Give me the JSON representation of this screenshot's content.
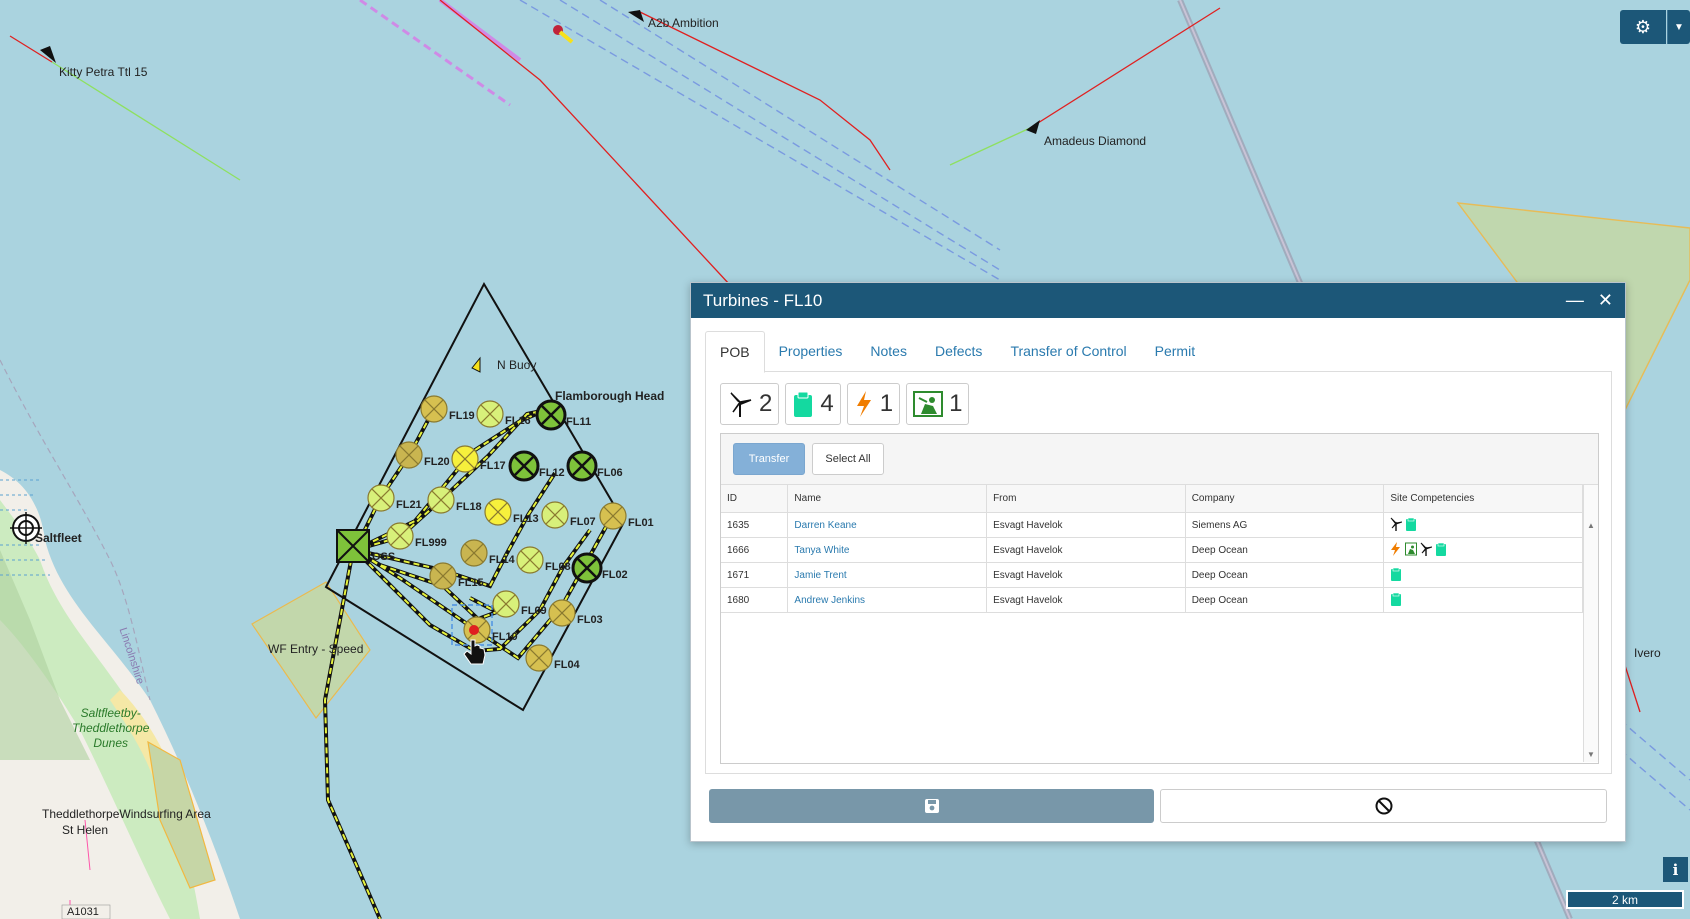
{
  "map": {
    "vessels": [
      {
        "name": "Kitty Petra Ttl 15"
      },
      {
        "name": "A2b Ambition"
      },
      {
        "name": "Amadeus Diamond"
      },
      {
        "name": "Ivero"
      }
    ],
    "places": {
      "saltfleet": "Saltfleet",
      "saltfleetby_line1": "Saltfleetby-",
      "saltfleetby_line2": "Theddlethorpe",
      "saltfleetby_line3": "Dunes",
      "theddlethorpe": "TheddlethorpeWindsurfing Area",
      "st_helen": "St Helen",
      "lincolnshire": "Lincolnshire",
      "road": "A1031",
      "wf_entry": "WF Entry - Speed",
      "n_buoy": "N Buoy",
      "flamborough": "Flamborough Head",
      "oss": "OSS"
    },
    "turbines": [
      "FL19",
      "FL16",
      "FL11",
      "FL20",
      "FL17",
      "FL12",
      "FL06",
      "FL21",
      "FL18",
      "FL13",
      "FL07",
      "FL01",
      "FL999",
      "FL14",
      "FL08",
      "FL02",
      "FL15",
      "FL09",
      "FL03",
      "FL10",
      "FL04"
    ],
    "scale": "2 km",
    "info": "i"
  },
  "dialog": {
    "title": "Turbines - FL10",
    "tabs": [
      "POB",
      "Properties",
      "Notes",
      "Defects",
      "Transfer of Control",
      "Permit"
    ],
    "badges": [
      {
        "icon": "turbine-icon",
        "count": "2"
      },
      {
        "icon": "clipboard-icon",
        "count": "4"
      },
      {
        "icon": "lightning-icon",
        "count": "1"
      },
      {
        "icon": "first-aid-icon",
        "count": "1"
      }
    ],
    "toolbar": {
      "transfer": "Transfer",
      "select_all": "Select All"
    },
    "columns": [
      "ID",
      "Name",
      "From",
      "Company",
      "Site Competencies"
    ],
    "rows": [
      {
        "id": "1635",
        "name": "Darren Keane",
        "from": "Esvagt Havelok",
        "company": "Siemens AG",
        "competencies": [
          "turbine",
          "clipboard"
        ]
      },
      {
        "id": "1666",
        "name": "Tanya White",
        "from": "Esvagt Havelok",
        "company": "Deep Ocean",
        "competencies": [
          "lightning",
          "first-aid",
          "turbine",
          "clipboard"
        ]
      },
      {
        "id": "1671",
        "name": "Jamie Trent",
        "from": "Esvagt Havelok",
        "company": "Deep Ocean",
        "competencies": [
          "clipboard"
        ]
      },
      {
        "id": "1680",
        "name": "Andrew Jenkins",
        "from": "Esvagt Havelok",
        "company": "Deep Ocean",
        "competencies": [
          "clipboard"
        ]
      }
    ]
  },
  "colors": {
    "header": "#1c5778",
    "sea": "#aad3df",
    "accent_green": "#14d9a0",
    "lightning": "#f07d00"
  }
}
